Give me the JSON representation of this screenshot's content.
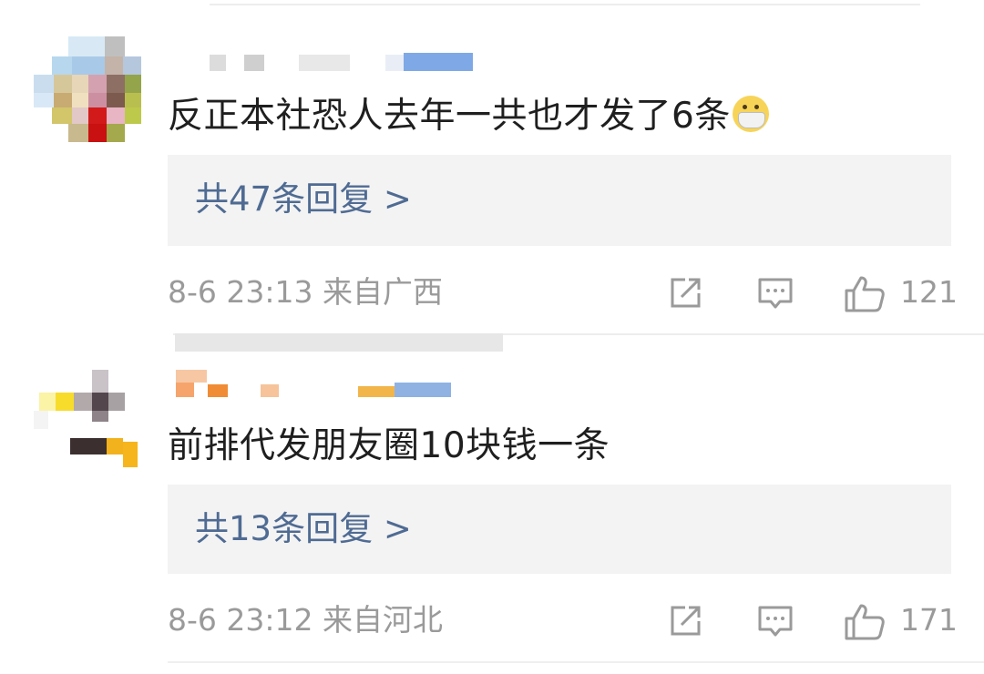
{
  "comments": [
    {
      "text": "反正本社恐人去年一共也才发了6条",
      "emoji": "mask-face-emoji",
      "replies_label": "共47条回复 >",
      "timestamp": "8-6 23:13",
      "location": "来自广西",
      "likes": "121"
    },
    {
      "text": "前排代发朋友圈10块钱一条",
      "replies_label": "共13条回复 >",
      "timestamp": "8-6 23:12",
      "location": "来自河北",
      "likes": "171"
    }
  ],
  "icons": {
    "share": "share-icon",
    "comment": "comment-icon",
    "like": "thumbs-up-icon"
  },
  "colors": {
    "reply_link": "#4f6b93",
    "meta_text": "#9a9a9a",
    "reply_box_bg": "#f3f3f3"
  }
}
